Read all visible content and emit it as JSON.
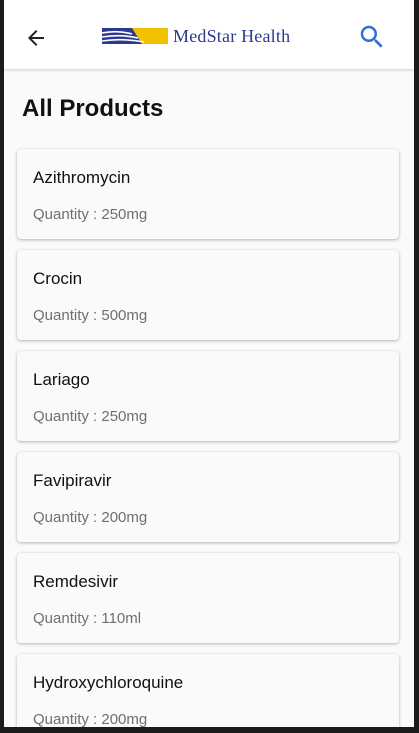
{
  "header": {
    "back_icon": "arrow-back-icon",
    "logo_text": "MedStar Health",
    "search_icon": "search-icon",
    "colors": {
      "logo_blue": "#2b3a8f",
      "logo_gold": "#f2c200",
      "search_blue": "#2f6fd6"
    }
  },
  "page": {
    "title": "All Products"
  },
  "products": [
    {
      "name": "Azithromycin",
      "quantity": "Quantity : 250mg"
    },
    {
      "name": "Crocin",
      "quantity": "Quantity : 500mg"
    },
    {
      "name": "Lariago",
      "quantity": "Quantity : 250mg"
    },
    {
      "name": "Favipiravir",
      "quantity": "Quantity : 200mg"
    },
    {
      "name": "Remdesivir",
      "quantity": "Quantity : 110ml"
    },
    {
      "name": "Hydroxychloroquine",
      "quantity": "Quantity : 200mg"
    }
  ]
}
